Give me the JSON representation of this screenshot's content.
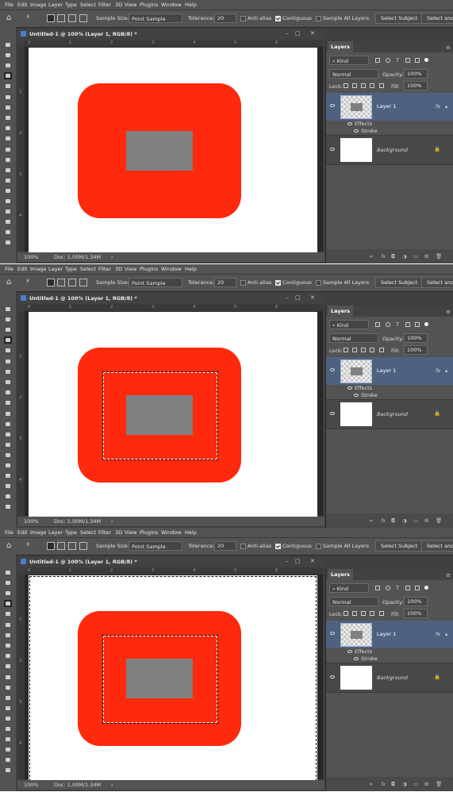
{
  "menu": [
    "File",
    "Edit",
    "Image",
    "Layer",
    "Type",
    "Select",
    "Filter",
    "3D",
    "View",
    "Plugins",
    "Window",
    "Help"
  ],
  "options": {
    "sample_size_label": "Sample Size:",
    "sample_size_value": "Point Sample",
    "tolerance_label": "Tolerance:",
    "tolerance_value": "20",
    "anti_alias": "Anti-alias",
    "contiguous": "Contiguous",
    "sample_all_layers": "Sample All Layers",
    "select_subject": "Select Subject",
    "select_and_mask": "Select and M"
  },
  "document": {
    "tab_title": "Untitled-1 @ 100% (Layer 1, RGB/8) *",
    "zoom": "100%",
    "doc_size": "Doc: 1.00M/1.34M",
    "ruler_h": [
      "0",
      "1",
      "2",
      "3",
      "4",
      "5",
      "6"
    ],
    "ruler_v": [
      "1",
      "2",
      "3",
      "4"
    ]
  },
  "layers_panel": {
    "tab": "Layers",
    "kind": "Kind",
    "blend_mode": "Normal",
    "opacity_label": "Opacity:",
    "opacity_value": "100%",
    "lock_label": "Lock:",
    "fill_label": "Fill:",
    "fill_value": "100%",
    "layer1_name": "Layer 1",
    "fx": "fx",
    "effects": "Effects",
    "stroke": "Stroke",
    "background_name": "Background"
  },
  "colors": {
    "shape_red": "#ff2a0e",
    "inner_gray": "#808080",
    "selected_layer": "#4e6280"
  },
  "panels": [
    {
      "selection": "none"
    },
    {
      "selection": "inner"
    },
    {
      "selection": "inner_and_canvas"
    }
  ]
}
